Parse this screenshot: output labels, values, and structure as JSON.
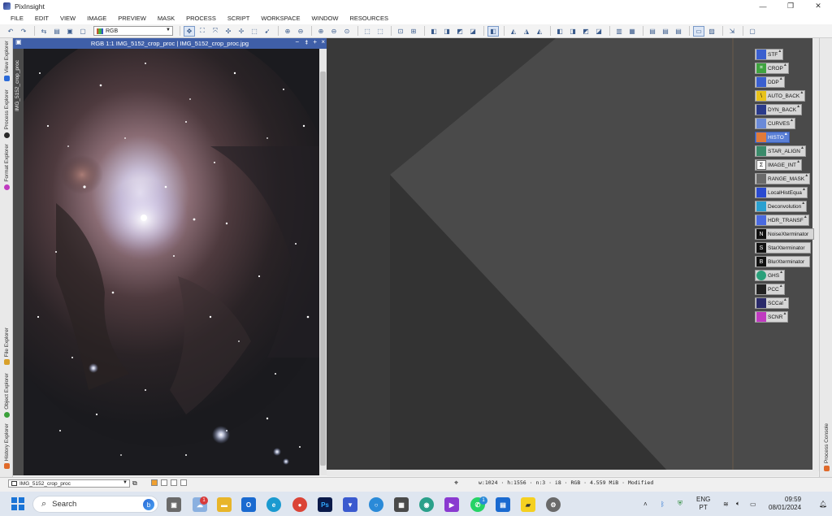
{
  "window": {
    "title": "PixInsight",
    "controls": {
      "minimize": "—",
      "maximize": "❐",
      "close": "✕"
    }
  },
  "menu": [
    "FILE",
    "EDIT",
    "VIEW",
    "IMAGE",
    "PREVIEW",
    "MASK",
    "PROCESS",
    "SCRIPT",
    "WORKSPACE",
    "WINDOW",
    "RESOURCES"
  ],
  "toolbar": {
    "channel_select": "RGB"
  },
  "left_dock": {
    "tabs": [
      "View Explorer",
      "Process Explorer",
      "Format Explorer",
      "File Explorer",
      "Object Explorer",
      "History Explorer"
    ]
  },
  "image_window": {
    "title": "RGB 1:1 IMG_5152_crop_proc | IMG_5152_crop_proc.jpg",
    "side_label": "IMG_5152_crop_proc",
    "controls": {
      "minimize": "−",
      "shade": "⯒",
      "maximize": "+",
      "close": "×"
    }
  },
  "process_icons": [
    {
      "label": "STF",
      "icon": "stf-icon",
      "color": "#3a5fcf",
      "glyph": ""
    },
    {
      "label": "CROP",
      "icon": "crop-icon",
      "color": "#3fa33f",
      "glyph": "⌗"
    },
    {
      "label": "DDP",
      "icon": "ddp-icon",
      "color": "#3a5fcf",
      "glyph": ""
    },
    {
      "label": "AUTO_BACK",
      "icon": "autoback-icon",
      "color": "#e8c21a",
      "glyph": "\\"
    },
    {
      "label": "DYN_BACK",
      "icon": "dynback-icon",
      "color": "#2a3a8a",
      "glyph": ""
    },
    {
      "label": "CURVES",
      "icon": "curves-icon",
      "color": "#6a8ad8",
      "glyph": ""
    },
    {
      "label": "HISTO",
      "icon": "histogram-icon",
      "color": "#e07a3a",
      "glyph": ""
    },
    {
      "label": "STAR_ALIGN",
      "icon": "star-align-icon",
      "color": "#3a8a6a",
      "glyph": ""
    },
    {
      "label": "IMAGE_INT",
      "icon": "sum-icon",
      "color": "#ffffff",
      "glyph": "Σ"
    },
    {
      "label": "RANGE_MASK",
      "icon": "range-mask-icon",
      "color": "#6a6a6a",
      "glyph": ""
    },
    {
      "label": "LocalHistEqua",
      "icon": "local-hist-icon",
      "color": "#2a4acf",
      "glyph": ""
    },
    {
      "label": "Deconvolution",
      "icon": "deconvolution-icon",
      "color": "#2aa0d0",
      "glyph": ""
    },
    {
      "label": "HDR_TRANSF",
      "icon": "hdr-icon",
      "color": "#4a6ae0",
      "glyph": ""
    },
    {
      "label": "NoiseXterminator",
      "icon": "noisex-icon",
      "color": "#111111",
      "glyph": "N"
    },
    {
      "label": "StarXterminator",
      "icon": "starx-icon",
      "color": "#111111",
      "glyph": "S"
    },
    {
      "label": "BlurXterminator",
      "icon": "blurx-icon",
      "color": "#111111",
      "glyph": "B"
    },
    {
      "label": "GHS",
      "icon": "ghs-icon",
      "color": "#2aa07a",
      "glyph": ""
    },
    {
      "label": "PCC",
      "icon": "pcc-icon",
      "color": "#222222",
      "glyph": ""
    },
    {
      "label": "SCCal",
      "icon": "sccal-icon",
      "color": "#2a2a6a",
      "glyph": ""
    },
    {
      "label": "SCNR",
      "icon": "scnr-icon",
      "color": "#c03ac0",
      "glyph": ""
    }
  ],
  "right_dock": {
    "tab": "Process Console"
  },
  "statusbar": {
    "view_select": "IMG_5152_crop_proc",
    "info": "w:1024 · h:1556 · n:3 · i8 · RGB · 4.559 MiB · Modified"
  },
  "taskbar": {
    "search_placeholder": "Search",
    "apps": [
      {
        "name": "task-view",
        "color": "#6a6a6a",
        "label": ""
      },
      {
        "name": "weather",
        "color": "#8ab0e0",
        "label": ""
      },
      {
        "name": "file-explorer",
        "color": "#e8b52a",
        "label": ""
      },
      {
        "name": "outlook",
        "color": "#1a6ad0",
        "label": ""
      },
      {
        "name": "edge",
        "color": "#1a9ad0",
        "label": ""
      },
      {
        "name": "chrome",
        "color": "#db4437",
        "label": ""
      },
      {
        "name": "photoshop",
        "color": "#0a1a4a",
        "label": "Ps"
      },
      {
        "name": "pixinsight",
        "color": "#3a5acf",
        "label": ""
      },
      {
        "name": "app-ring",
        "color": "#2a8ad8",
        "label": ""
      },
      {
        "name": "calculator",
        "color": "#4a4a4a",
        "label": ""
      },
      {
        "name": "maps",
        "color": "#2aa08a",
        "label": ""
      },
      {
        "name": "clipchamp",
        "color": "#8a3ad0",
        "label": ""
      },
      {
        "name": "whatsapp",
        "color": "#25d366",
        "label": ""
      },
      {
        "name": "store",
        "color": "#1a6ad0",
        "label": ""
      },
      {
        "name": "sticky-notes",
        "color": "#f5d020",
        "label": ""
      },
      {
        "name": "settings",
        "color": "#6a6a6a",
        "label": ""
      }
    ],
    "weather_badge": "1",
    "whatsapp_badge": "1",
    "lang_1": "ENG",
    "lang_2": "PT",
    "time": "09:59",
    "date": "08/01/2024"
  },
  "colors": {
    "image_title_bar": "#3f5fa8",
    "workspace": "#3a3a3a",
    "selected_process": "#5a7fd6"
  }
}
